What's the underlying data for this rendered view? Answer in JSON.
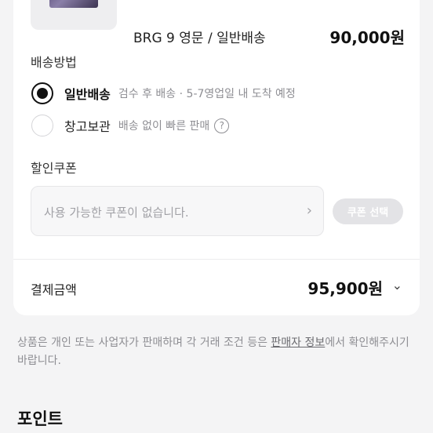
{
  "product": {
    "name": "BRG 9 영문 / 일반배송",
    "price": "90,000원"
  },
  "shipping": {
    "section_label": "배송방법",
    "options": [
      {
        "title": "일반배송",
        "desc": "검수 후 배송 · 5-7영업일 내 도착 예정",
        "selected": true
      },
      {
        "title": "창고보관",
        "desc": "배송 없이 빠른 판매",
        "selected": false
      }
    ],
    "help_icon": "?"
  },
  "coupon": {
    "section_label": "할인쿠폰",
    "placeholder": "사용 가능한 쿠폰이 없습니다.",
    "chevron": "›",
    "button_label": "쿠폰 선택"
  },
  "total": {
    "label": "결제금액",
    "value": "95,900원",
    "chevron": "⌄"
  },
  "notice": {
    "before": "상품은 개인 또는 사업자가 판매하며 각 거래 조건 등은 ",
    "link": "판매자 정보",
    "after": "에서 확인해주시기 바랍니다."
  },
  "points": {
    "title": "포인트"
  }
}
